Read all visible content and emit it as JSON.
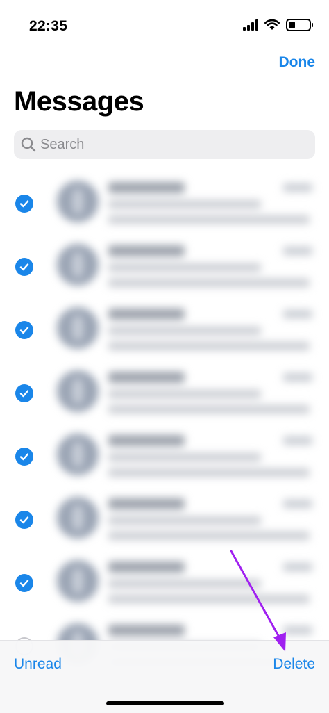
{
  "status_bar": {
    "time": "22:35",
    "icons": [
      "signal-icon",
      "wifi-icon",
      "battery-icon"
    ]
  },
  "header": {
    "done_label": "Done",
    "title": "Messages"
  },
  "search": {
    "placeholder": "Search",
    "icon": "search-icon"
  },
  "conversations": [
    {
      "selected": true
    },
    {
      "selected": true
    },
    {
      "selected": true
    },
    {
      "selected": true
    },
    {
      "selected": true
    },
    {
      "selected": true
    },
    {
      "selected": true
    },
    {
      "selected": false
    }
  ],
  "toolbar": {
    "unread_label": "Unread",
    "delete_label": "Delete"
  },
  "colors": {
    "accent": "#1a86e9",
    "annotation_arrow": "#a020f0",
    "search_bg": "#eeeef0"
  }
}
